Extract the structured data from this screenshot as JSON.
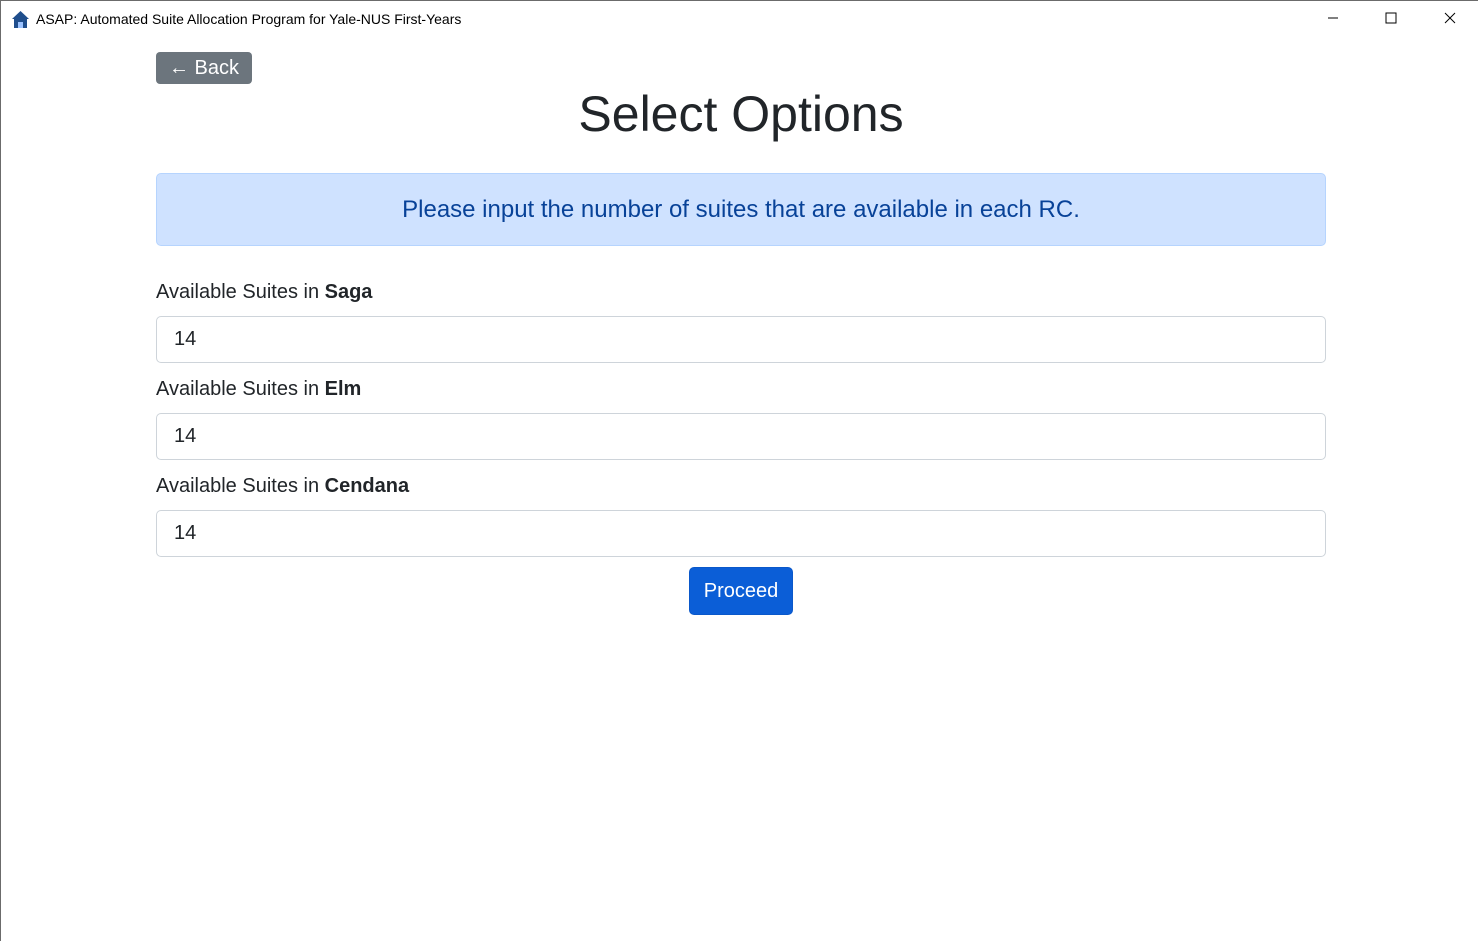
{
  "window": {
    "title": "ASAP: Automated Suite Allocation Program for Yale-NUS First-Years",
    "icon": "house-icon",
    "controls": [
      "minimize-icon",
      "maximize-icon",
      "close-icon"
    ]
  },
  "nav": {
    "back_label": "← Back"
  },
  "page": {
    "title": "Select Options",
    "alert_text": "Please input the number of suites that are available in each RC."
  },
  "fields": [
    {
      "label_prefix": "Available Suites in ",
      "rc": "Saga",
      "value": "14"
    },
    {
      "label_prefix": "Available Suites in ",
      "rc": "Elm",
      "value": "14"
    },
    {
      "label_prefix": "Available Suites in ",
      "rc": "Cendana",
      "value": "14"
    }
  ],
  "actions": {
    "proceed_label": "Proceed"
  },
  "colors": {
    "secondary_button": "#6c757d",
    "primary_button": "#0b5ed7",
    "alert_bg": "#cfe2ff",
    "alert_text": "#084298"
  }
}
